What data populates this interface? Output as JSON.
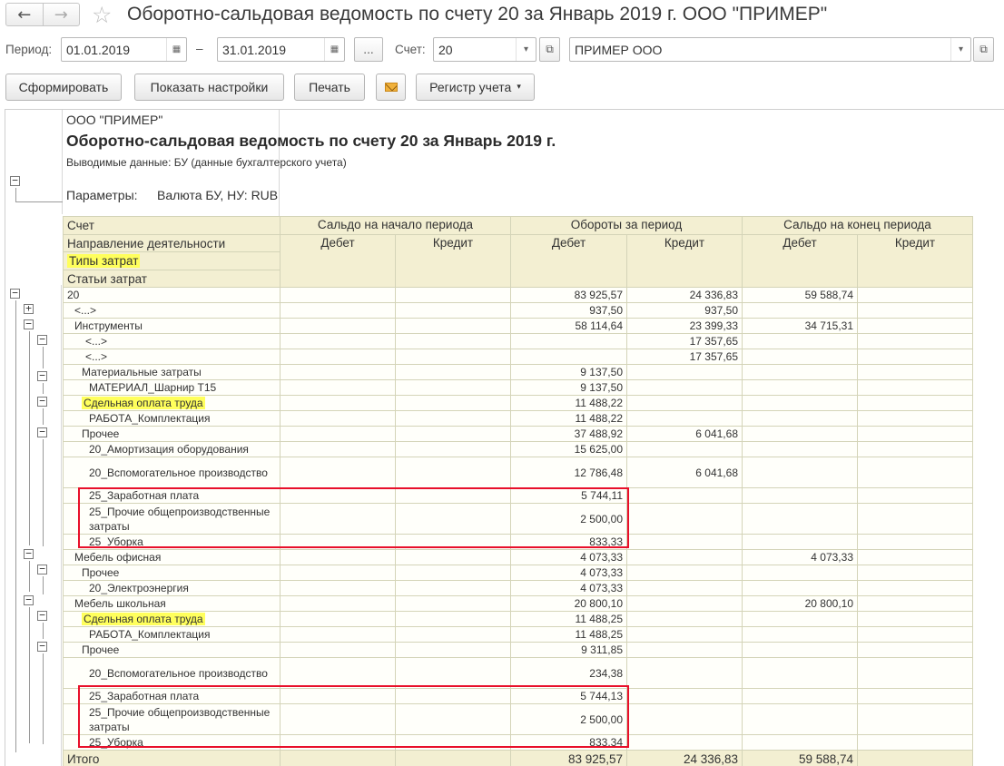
{
  "window": {
    "title": "Оборотно-сальдовая ведомость по счету 20 за Январь 2019 г. ООО \"ПРИМЕР\"",
    "back_icon": "arrow-left-icon",
    "forward_icon": "arrow-right-icon",
    "favorite_icon": "star-icon"
  },
  "filters": {
    "period_label": "Период:",
    "date_from": "01.01.2019",
    "dash": "–",
    "date_to": "31.01.2019",
    "ellipsis_btn": "...",
    "account_label": "Счет:",
    "account_value": "20",
    "org_value": "ПРИМЕР ООО"
  },
  "toolbar": {
    "generate": "Сформировать",
    "settings": "Показать настройки",
    "print": "Печать",
    "register": "Регистр учета"
  },
  "report": {
    "org": "ООО \"ПРИМЕР\"",
    "title": "Оборотно-сальдовая ведомость по счету 20 за Январь 2019 г.",
    "output_data": "Выводимые данные:  БУ (данные бухгалтерского учета)",
    "params_label": "Параметры:",
    "params_value": "Валюта БУ, НУ: RUB",
    "header": {
      "row_labels": [
        "Счет",
        "Направление деятельности",
        "Типы затрат",
        "Статьи затрат"
      ],
      "groups": [
        "Сальдо на начало периода",
        "Обороты за период",
        "Сальдо на конец периода"
      ],
      "debit": "Дебет",
      "credit": "Кредит"
    },
    "rows": [
      {
        "name": "20",
        "od": "83 925,57",
        "oc": "24 336,83",
        "ed": "59 588,74"
      },
      {
        "name": "<...>",
        "od": "937,50",
        "oc": "937,50",
        "ed": ""
      },
      {
        "name": "Инструменты",
        "od": "58 114,64",
        "oc": "23 399,33",
        "ed": "34 715,31"
      },
      {
        "name": "<...>",
        "od": "",
        "oc": "17 357,65",
        "ed": ""
      },
      {
        "name": "<...>",
        "od": "",
        "oc": "17 357,65",
        "ed": ""
      },
      {
        "name": "Материальные затраты",
        "od": "9 137,50",
        "oc": "",
        "ed": ""
      },
      {
        "name": "МАТЕРИАЛ_Шарнир Т15",
        "od": "9 137,50",
        "oc": "",
        "ed": ""
      },
      {
        "name": "Сдельная оплата труда",
        "od": "11 488,22",
        "oc": "",
        "ed": ""
      },
      {
        "name": "РАБОТА_Комплектация",
        "od": "11 488,22",
        "oc": "",
        "ed": ""
      },
      {
        "name": "Прочее",
        "od": "37 488,92",
        "oc": "6 041,68",
        "ed": ""
      },
      {
        "name": "20_Амортизация оборудования",
        "od": "15 625,00",
        "oc": "",
        "ed": ""
      },
      {
        "name": "20_Вспомогательное производство",
        "od": "12 786,48",
        "oc": "6 041,68",
        "ed": ""
      },
      {
        "name": "25_Заработная плата",
        "od": "5 744,11",
        "oc": "",
        "ed": ""
      },
      {
        "name": "25_Прочие общепроизводственные затраты",
        "od": "2 500,00",
        "oc": "",
        "ed": ""
      },
      {
        "name": "25_Уборка",
        "od": "833,33",
        "oc": "",
        "ed": ""
      },
      {
        "name": "Мебель офисная",
        "od": "4 073,33",
        "oc": "",
        "ed": "4 073,33"
      },
      {
        "name": "Прочее",
        "od": "4 073,33",
        "oc": "",
        "ed": ""
      },
      {
        "name": "20_Электроэнергия",
        "od": "4 073,33",
        "oc": "",
        "ed": ""
      },
      {
        "name": "Мебель школьная",
        "od": "20 800,10",
        "oc": "",
        "ed": "20 800,10"
      },
      {
        "name": "Сдельная оплата труда",
        "od": "11 488,25",
        "oc": "",
        "ed": ""
      },
      {
        "name": "РАБОТА_Комплектация",
        "od": "11 488,25",
        "oc": "",
        "ed": ""
      },
      {
        "name": "Прочее",
        "od": "9 311,85",
        "oc": "",
        "ed": ""
      },
      {
        "name": "20_Вспомогательное производство",
        "od": "234,38",
        "oc": "",
        "ed": ""
      },
      {
        "name": "25_Заработная плата",
        "od": "5 744,13",
        "oc": "",
        "ed": ""
      },
      {
        "name": "25_Прочие общепроизводственные затраты",
        "od": "2 500,00",
        "oc": "",
        "ed": ""
      },
      {
        "name": "25_Уборка",
        "od": "833,34",
        "oc": "",
        "ed": ""
      }
    ],
    "total": {
      "name": "Итого",
      "od": "83 925,57",
      "oc": "24 336,83",
      "ed": "59 588,74"
    }
  },
  "colors": {
    "header_bg": "#f3efd2",
    "highlight": "#ffff5c",
    "annotation_red": "#e8102a"
  }
}
